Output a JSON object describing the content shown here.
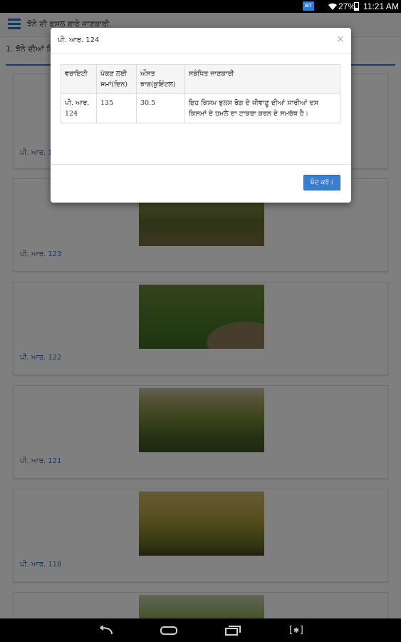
{
  "status_bar": {
    "badge": "BT",
    "battery_percent": "27%",
    "time": "11:21 AM"
  },
  "header": {
    "title": "ਝੋਨੇ ਦੀ ਫ਼ਸਲ ਬਾਰੇ ਜਾਣਕਾਰੀ",
    "section_title": "1. ਝੋਨੇ ਦੀਆਂ ਕਿਸਮਾਂ"
  },
  "cards": [
    {
      "label": "ਪੀ. ਆਰ. 124"
    },
    {
      "label": "ਪੀ. ਆਰ. 123"
    },
    {
      "label": "ਪੀ. ਆਰ. 122"
    },
    {
      "label": "ਪੀ. ਆਰ. 121"
    },
    {
      "label": "ਪੀ. ਆਰ. 118"
    },
    {
      "label": ""
    }
  ],
  "dialog": {
    "title": "ਪੀ. ਆਰ. 124",
    "close_symbol": "×",
    "columns": [
      "ਵਰਾਇਟੀ",
      "ਪੱਕਣ ਲਈ ਸਮਾਂ(ਦਿਨ)",
      "ਔਸਤ ਝਾੜ(ਕੁਇੰਟਲ)",
      "ਸਬੰਧਿਤ ਜਾਣਕਾਰੀ"
    ],
    "row": {
      "variety": "ਪੀ. ਆਰ. 124",
      "days": "135",
      "yield": "30.5",
      "info": "ਇਹ ਕਿਸਮ ਝੁਲਸ ਰੋਗ ਦੇ ਜੀਵਾਣੂ ਦੀਆਂ ਸਾਰੀਆਂ ਦਸ ਕਿਸਮਾਂ ਦੇ ਹਮਲੇ ਦਾ ਟਾਕਰਾ ਕਰਨ ਦੇ ਸਮਰੱਥ ਹੈ।"
    },
    "close_button": "ਬੰਦ ਕਰੋ।"
  },
  "nav_bar": {
    "back_icon": "back-icon",
    "home_icon": "home-icon",
    "recent_icon": "recent-apps-icon",
    "screenshot_icon": "screenshot-icon",
    "screenshot_glyph": "[✱]"
  },
  "colors": {
    "accent": "#3a7ed0",
    "label_blue": "#3a6fbf",
    "section_rule": "#3a78c8"
  }
}
